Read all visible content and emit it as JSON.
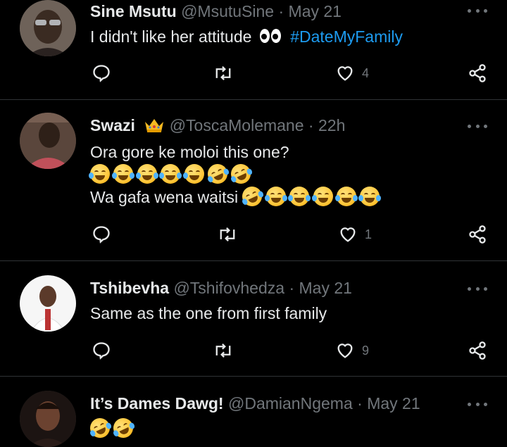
{
  "tweets": [
    {
      "name": "Sine Msutu",
      "handle": "@MsutuSine",
      "dot": "·",
      "time": "May 21",
      "lines": [
        "I didn't like her attitude"
      ],
      "hashtag": "#DateMyFamily",
      "likes": "4",
      "avatar_colors": [
        "#7a6a5c",
        "#2b241e"
      ]
    },
    {
      "name": "Swazi",
      "handle": "@ToscaMolemane",
      "dot": "·",
      "time": "22h",
      "lines": [
        "Ora gore ke moloi this one?",
        "",
        "Wa gafa wena waitsi"
      ],
      "likes": "1",
      "avatar_colors": [
        "#a45040",
        "#3a2a24"
      ]
    },
    {
      "name": "Tshibevha",
      "handle": "@Tshifovhedza",
      "dot": "·",
      "time": "May 21",
      "lines": [
        "Same as the one from first family"
      ],
      "likes": "9",
      "avatar_colors": [
        "#f2f2f2",
        "#6a4a3a"
      ]
    },
    {
      "name": "It’s Dames Dawg!",
      "handle": "@DamianNgema",
      "dot": "·",
      "time": "May 21",
      "lines": [
        ""
      ],
      "avatar_colors": [
        "#5a3a2a",
        "#1a1210"
      ]
    }
  ],
  "icons": {
    "reply": "reply-icon",
    "retweet": "retweet-icon",
    "like": "like-icon",
    "share": "share-icon",
    "more": "more-icon",
    "eyes": "eyes-emoji",
    "crown": "crown-emoji",
    "laugh": "laughing-emoji",
    "rofl": "rolling-laughing-emoji",
    "tears": "tears-of-joy-emoji"
  },
  "colors": {
    "background": "#000000",
    "text": "#e7e9ea",
    "muted": "#71767b",
    "link": "#1d9bf0",
    "divider": "#2f3336"
  }
}
